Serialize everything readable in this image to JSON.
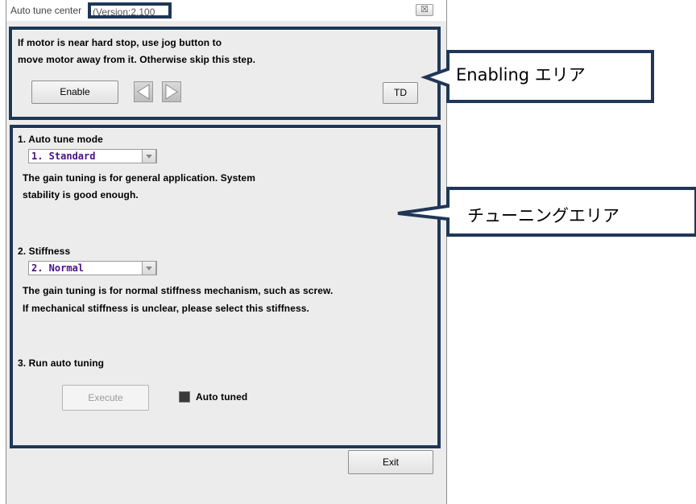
{
  "window": {
    "title": "Auto tune center",
    "version": "(Version:2.100",
    "close_glyph": "☒"
  },
  "enable_section": {
    "instruction_line1": "If motor is near hard stop, use jog button to",
    "instruction_line2": "move motor away from it. Otherwise skip this step.",
    "enable_button": "Enable",
    "td_button": "TD"
  },
  "tuning": {
    "mode_label": "1. Auto tune mode",
    "mode_value": "1. Standard",
    "mode_desc_line1": "The gain tuning is for general application. System",
    "mode_desc_line2": "stability is good enough.",
    "stiffness_label": "2. Stiffness",
    "stiffness_value": "2. Normal",
    "stiffness_desc_line1": "The gain tuning is for normal stiffness mechanism, such as screw.",
    "stiffness_desc_line2": "If mechanical stiffness is unclear, please select this stiffness.",
    "run_label": "3. Run auto tuning",
    "execute_button": "Execute",
    "auto_tuned_label": "Auto tuned"
  },
  "footer": {
    "exit_button": "Exit"
  },
  "callouts": {
    "enabling": "Enabling エリア",
    "tuning": "チューニングエリア"
  },
  "colors": {
    "highlight": "#1f3757",
    "combo_text": "#4b0f8a"
  }
}
